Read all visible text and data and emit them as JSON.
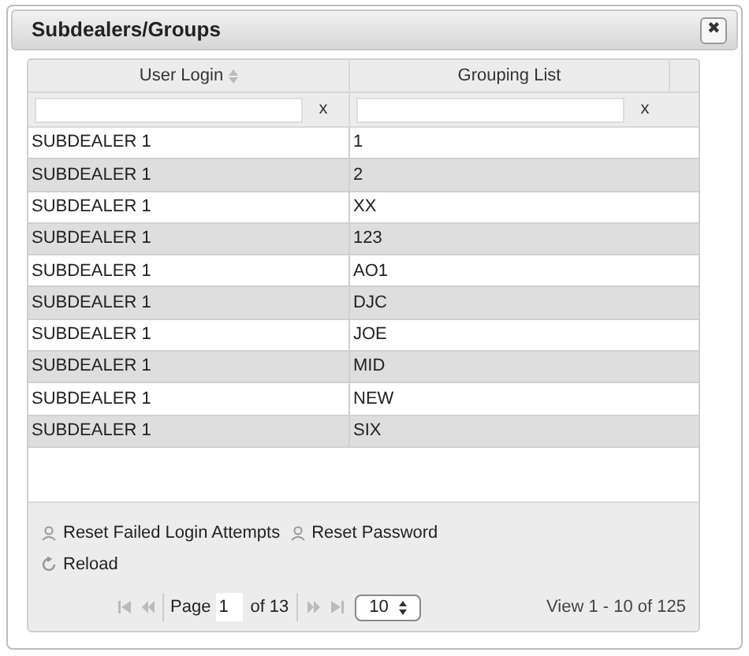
{
  "window": {
    "title": "Subdealers/Groups",
    "close": "✖"
  },
  "table": {
    "columns": [
      {
        "label": "User Login",
        "sortable": true
      },
      {
        "label": "Grouping List",
        "sortable": false
      }
    ],
    "filters": [
      {
        "clear": "x"
      },
      {
        "clear": "x"
      }
    ],
    "rows": [
      [
        "SUBDEALER 1",
        "1"
      ],
      [
        "SUBDEALER 1",
        "2"
      ],
      [
        "SUBDEALER 1",
        "XX"
      ],
      [
        "SUBDEALER 1",
        "123"
      ],
      [
        "SUBDEALER 1",
        "AO1"
      ],
      [
        "SUBDEALER 1",
        "DJC"
      ],
      [
        "SUBDEALER 1",
        "JOE"
      ],
      [
        "SUBDEALER 1",
        "MID"
      ],
      [
        "SUBDEALER 1",
        "NEW"
      ],
      [
        "SUBDEALER 1",
        "SIX"
      ]
    ]
  },
  "actions": [
    {
      "kind": "user",
      "label": "Reset Failed Login Attempts"
    },
    {
      "kind": "user",
      "label": "Reset Password"
    },
    {
      "kind": "reload",
      "label": "Reload"
    }
  ],
  "pager": {
    "page_label": "Page",
    "page": "1",
    "of": "of 13",
    "page_size": "10",
    "summary": "View 1 - 10 of 125"
  }
}
